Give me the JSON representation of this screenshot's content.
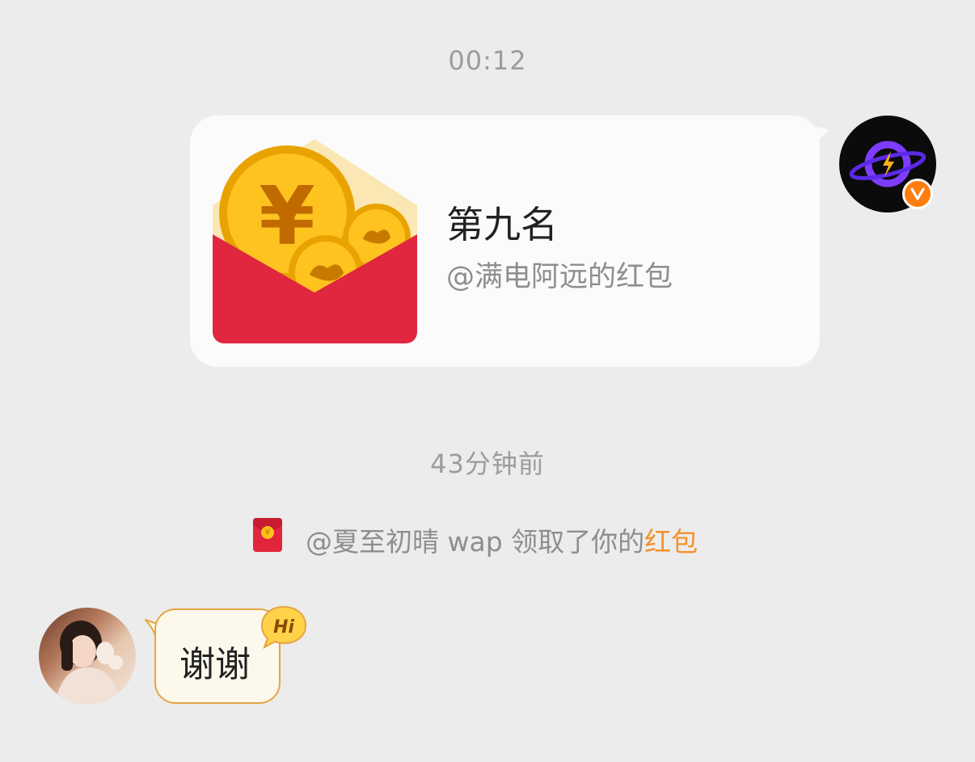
{
  "timestamps": {
    "top": "00:12",
    "middle": "43分钟前"
  },
  "red_packet": {
    "title": "第九名",
    "subtitle": "@满电阿远的红包",
    "coin_symbol": "¥"
  },
  "notice": {
    "coin_symbol": "¥",
    "text_prefix": "@夏至初晴 wap 领取了你的",
    "text_highlight": "红包"
  },
  "reply": {
    "text": "谢谢",
    "badge": "Hi"
  },
  "sender_badge": "V",
  "colors": {
    "background": "#ececec",
    "bubble": "#fbfbfb",
    "red_packet_red": "#e1263c",
    "coin_gold": "#ffc21c",
    "highlight_orange": "#f3902a",
    "verified_orange": "#ff7d0e",
    "reply_border": "#e4a542",
    "avatar_purple": "#7d3cff"
  },
  "icons": {
    "sender_avatar": "lightning-orbit-logo",
    "verified": "verified-v-badge",
    "red_packet": "red-envelope-with-coins",
    "notice": "small-red-envelope",
    "reply_badge": "hi-speech-badge"
  }
}
